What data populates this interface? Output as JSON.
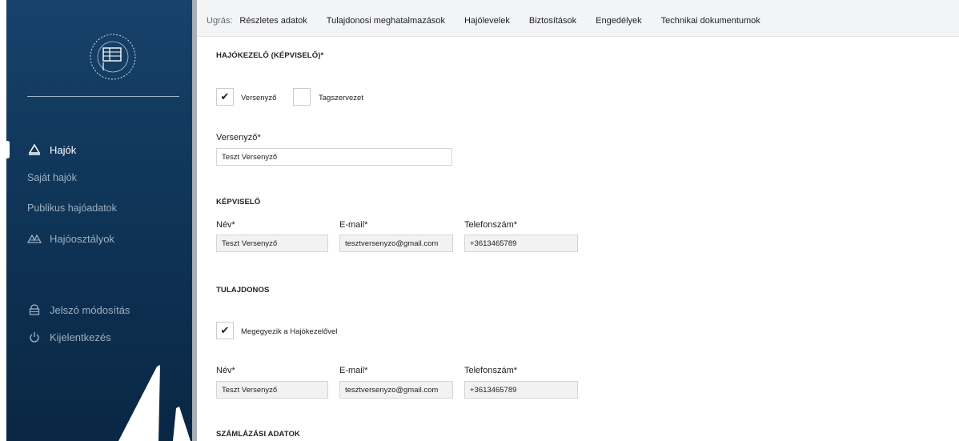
{
  "sidebar": {
    "nav": {
      "boats": "Hajók",
      "own_boats": "Saját hajók",
      "public_boat_data": "Publikus hajóadatok",
      "boat_classes": "Hajóosztályok",
      "change_password": "Jelszó módosítás",
      "logout": "Kijelentkezés"
    }
  },
  "topbar": {
    "jump_label": "Ugrás:",
    "links": [
      "Részletes adatok",
      "Tulajdonosi meghatalmazások",
      "Hajólevelek",
      "Biztosítások",
      "Engedélyek",
      "Technikai dokumentumok"
    ]
  },
  "operator": {
    "title": "HAJÓKEZELŐ (KÉPVISELŐ)*",
    "cb_competitor_label": "Versenyző",
    "cb_competitor_checked": true,
    "cb_member_label": "Tagszervezet",
    "cb_member_checked": false,
    "competitor_label": "Versenyző*",
    "competitor_value": "Teszt Versenyző"
  },
  "representative": {
    "title": "KÉPVISELŐ",
    "name_label": "Név*",
    "name_value": "Teszt Versenyző",
    "email_label": "E-mail*",
    "email_value": "tesztversenyzo@gmail.com",
    "phone_label": "Telefonszám*",
    "phone_value": "+3613465789"
  },
  "owner": {
    "title": "TULAJDONOS",
    "cb_same_label": "Megegyezik a Hajókezelővel",
    "cb_same_checked": true,
    "name_label": "Név*",
    "name_value": "Teszt Versenyző",
    "email_label": "E-mail*",
    "email_value": "tesztversenyzo@gmail.com",
    "phone_label": "Telefonszám*",
    "phone_value": "+3613465789"
  },
  "billing": {
    "title": "SZÁMLÁZÁSI ADATOK"
  },
  "icons": {
    "boat": "sailboat-icon",
    "boat_classes": "boat-classes-icon",
    "lock": "lock-icon",
    "power": "power-icon",
    "check": "checkmark-icon"
  }
}
